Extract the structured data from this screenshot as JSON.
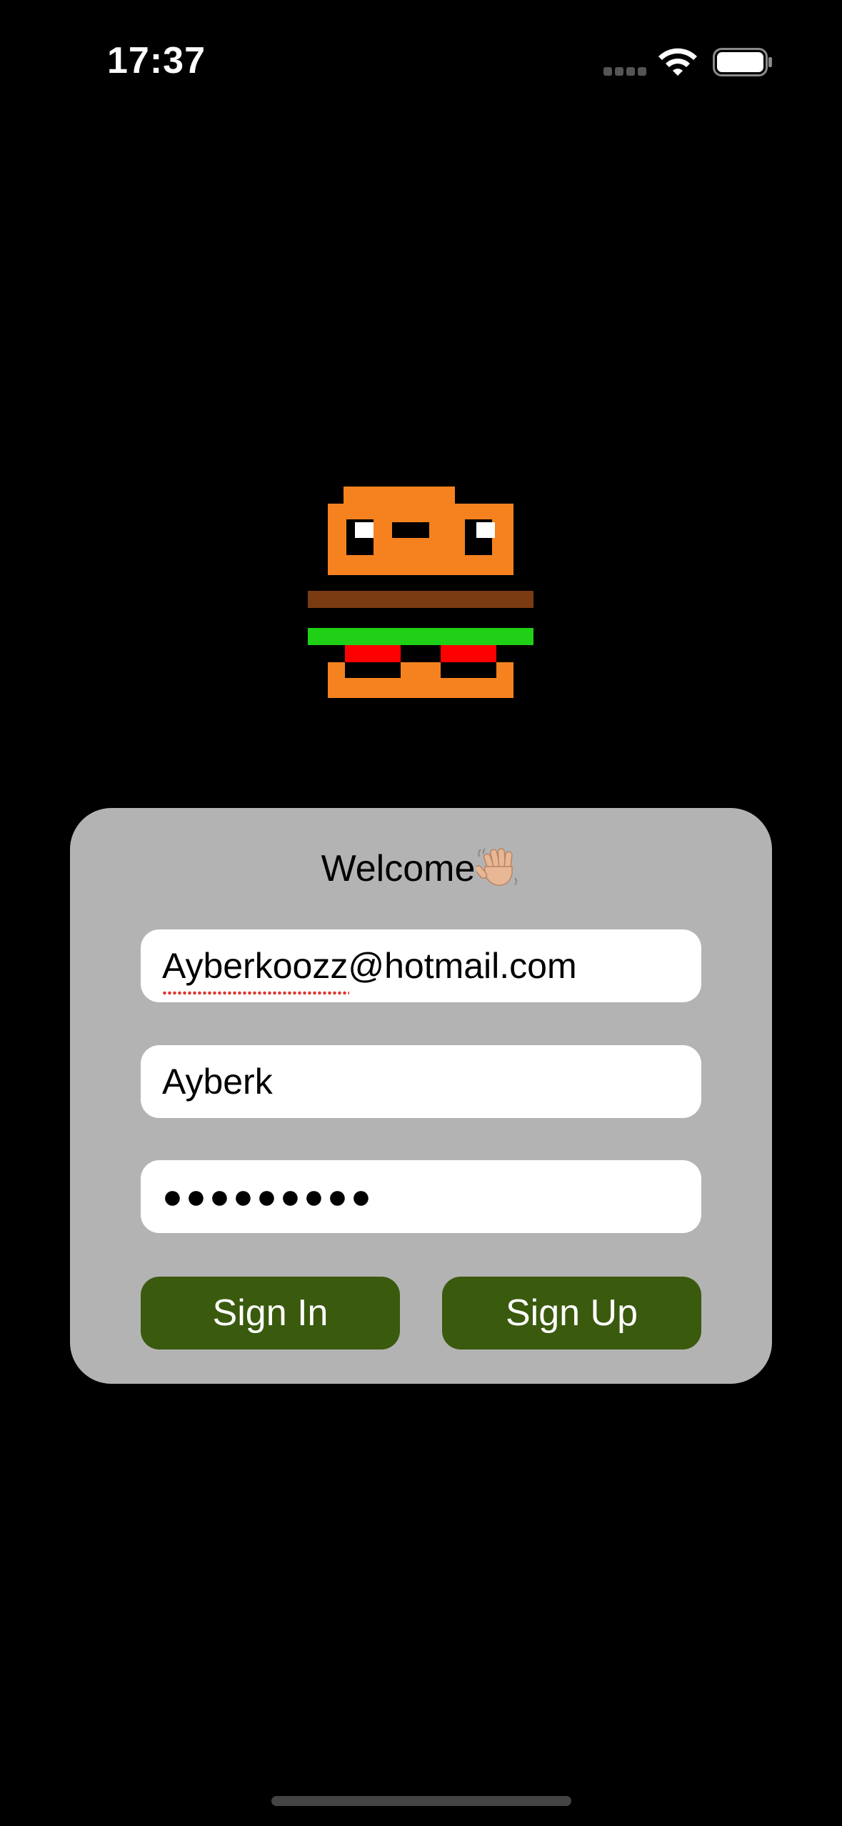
{
  "status_bar": {
    "time": "17:37",
    "icons": [
      "cellular-signal-icon",
      "wifi-icon",
      "battery-icon"
    ]
  },
  "logo": {
    "icon": "pixel-burger-icon",
    "colors": {
      "bun": "#f5821f",
      "patty": "#7a3b12",
      "lettuce": "#20d016",
      "tomato": "#ff0000",
      "eyes": "#ffffff"
    }
  },
  "card": {
    "welcome_text": "Welcome",
    "welcome_icon": "waving-hand-icon",
    "email_value": "Ayberkoozz@hotmail.com",
    "name_value": "Ayberk",
    "password_value": "●●●●●●●●●",
    "sign_in_label": "Sign In",
    "sign_up_label": "Sign Up"
  },
  "colors": {
    "background": "#000000",
    "card": "#b3b3b3",
    "button": "#3a5a0e",
    "button_text": "#ffffff"
  }
}
